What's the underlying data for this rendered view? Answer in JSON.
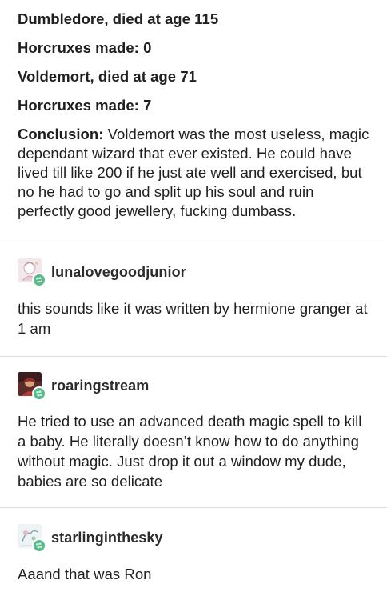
{
  "original_post": {
    "lines": [
      "Dumbledore, died at age 115",
      "Horcruxes made: 0",
      "Voldemort, died at age 71",
      "Horcruxes made: 7"
    ],
    "conclusion_label": "Conclusion:",
    "conclusion_text": " Voldemort was the most useless, magic dependant wizard that ever existed. He could have lived till like 200 if he just ate well and exercised, but no he had to go and split up his soul and ruin perfectly good jewellery, fucking dumbass."
  },
  "replies": [
    {
      "username": "lunalovegoodjunior",
      "text": "this sounds like it was written by hermione granger at 1 am",
      "avatar_icon": "pastel-sketch-avatar-icon",
      "avatar_colors": [
        "#f3e4ea",
        "#c9a9b8"
      ]
    },
    {
      "username": "roaringstream",
      "text": "He tried to use an advanced death magic spell to kill a baby. He literally doesn’t know how to do anything without magic. Just drop it out a window my dude, babies are so delicate",
      "avatar_icon": "portrait-avatar-icon",
      "avatar_colors": [
        "#5b2d2a",
        "#b23a3a"
      ]
    },
    {
      "username": "starlinginthesky",
      "text": "Aaand that was Ron",
      "avatar_icon": "light-sketch-avatar-icon",
      "avatar_colors": [
        "#eef3f5",
        "#9ab7c4"
      ]
    }
  ],
  "reblog_icon": "reblog-icon",
  "reblog_color": "#56bc8a"
}
